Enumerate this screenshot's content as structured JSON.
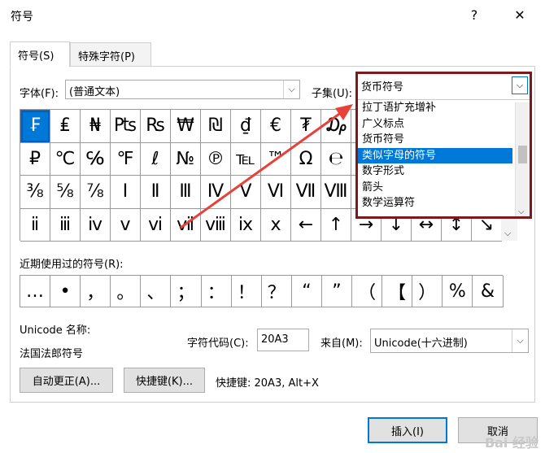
{
  "window": {
    "title": "符号",
    "help": "?",
    "close": "✕"
  },
  "tabs": [
    {
      "label": "符号(S)"
    },
    {
      "label": "特殊字符(P)"
    }
  ],
  "font": {
    "label": "字体(F):",
    "value": "(普通文本)"
  },
  "subset": {
    "label": "子集(U):",
    "value": "货币符号",
    "options": [
      "拉丁语扩充增补",
      "广义标点",
      "货币符号",
      "类似字母的符号",
      "数字形式",
      "箭头",
      "数学运算符"
    ],
    "highlighted_index": 3
  },
  "symbols": [
    [
      "₣",
      "₤",
      "₦",
      "₧",
      "₨",
      "₩",
      "₪",
      "₫",
      "€",
      "₮",
      "₯",
      "",
      "",
      "",
      "",
      ""
    ],
    [
      "₽",
      "℃",
      "℅",
      "℉",
      "ℓ",
      "№",
      "℗",
      "℡",
      "™",
      "Ω",
      "℮",
      "",
      "",
      "",
      "",
      ""
    ],
    [
      "⅜",
      "⅝",
      "⅞",
      "Ⅰ",
      "Ⅱ",
      "Ⅲ",
      "Ⅳ",
      "Ⅴ",
      "Ⅵ",
      "Ⅶ",
      "Ⅷ",
      "",
      "",
      "",
      "",
      ""
    ],
    [
      "ⅱ",
      "ⅲ",
      "ⅳ",
      "ⅴ",
      "ⅵ",
      "ⅶ",
      "ⅷ",
      "ⅸ",
      "ⅹ",
      "←",
      "↑",
      "→",
      "↓",
      "↔",
      "↕",
      "↘"
    ]
  ],
  "recent": {
    "label": "近期使用过的符号(R):",
    "items": [
      "…",
      "•",
      "，",
      "。",
      "、",
      "；",
      "：",
      "！",
      "？",
      "“",
      "”",
      "（",
      "【",
      "）",
      "%",
      "&"
    ]
  },
  "unicode_name": {
    "label": "Unicode 名称:",
    "value": "法国法郎符号"
  },
  "char_code": {
    "label": "字符代码(C):",
    "value": "20A3"
  },
  "from": {
    "label": "来自(M):",
    "value": "Unicode(十六进制)"
  },
  "buttons": {
    "autocorrect": "自动更正(A)...",
    "shortcut_key": "快捷键(K)...",
    "shortcut_text": "快捷键: 20A3, Alt+X",
    "insert": "插入(I)",
    "cancel": "取消"
  },
  "colors": {
    "accent": "#0078d7",
    "dropdown_border": "#7a1a1a",
    "arrow": "#e8413a"
  }
}
